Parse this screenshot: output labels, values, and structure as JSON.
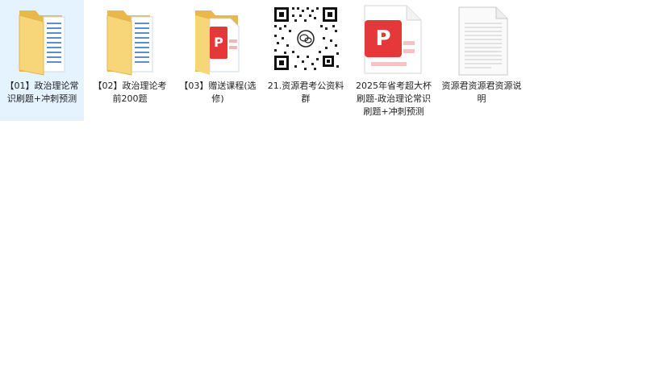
{
  "files": [
    {
      "name": "【01】政治理论常识刷题+冲刺预测",
      "kind": "folder",
      "selected": true
    },
    {
      "name": "【02】政治理论考前200题",
      "kind": "folder",
      "selected": false
    },
    {
      "name": "【03】赠送课程(选修)",
      "kind": "folder-with-pdf",
      "selected": false
    },
    {
      "name": "21.资源君考公资料群",
      "kind": "qr-image",
      "selected": false
    },
    {
      "name": "2025年省考超大杯刷题-政治理论常识刷题+冲刺预测",
      "kind": "pdf",
      "selected": false
    },
    {
      "name": "资源君资源君资源说明",
      "kind": "text-document",
      "selected": false
    }
  ],
  "colors": {
    "selection": "#e5f3ff",
    "folder": "#f5cf6a",
    "pdf_red": "#e5383b"
  }
}
